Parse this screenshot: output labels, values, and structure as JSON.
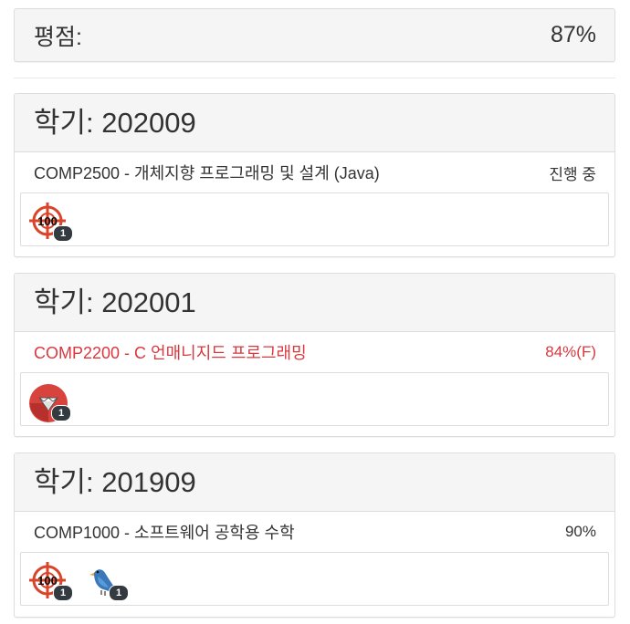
{
  "gpa": {
    "label": "평점:",
    "value": "87%"
  },
  "terms": [
    {
      "title": "학기: 202009",
      "course": {
        "name": "COMP2500 - 개체지향 프로그래밍 및 설계 (Java)",
        "status": "진행 중",
        "failed": false
      },
      "badges": [
        {
          "icon": "target-100-icon",
          "count": "1"
        }
      ]
    },
    {
      "title": "학기: 202001",
      "course": {
        "name": "COMP2200 - C 언매니지드 프로그래밍",
        "status": "84%(F)",
        "failed": true
      },
      "badges": [
        {
          "icon": "diamond-icon",
          "count": "1"
        }
      ]
    },
    {
      "title": "학기: 201909",
      "course": {
        "name": "COMP1000 - 소프트웨어 공학용 수학",
        "status": "90%",
        "failed": false
      },
      "badges": [
        {
          "icon": "target-100-icon",
          "count": "1"
        },
        {
          "icon": "bird-icon",
          "count": "1"
        }
      ]
    }
  ],
  "colors": {
    "failed": "#d9383e",
    "panel_header": "#f5f5f5",
    "border": "#dddddd",
    "count_badge": "#333a40"
  }
}
